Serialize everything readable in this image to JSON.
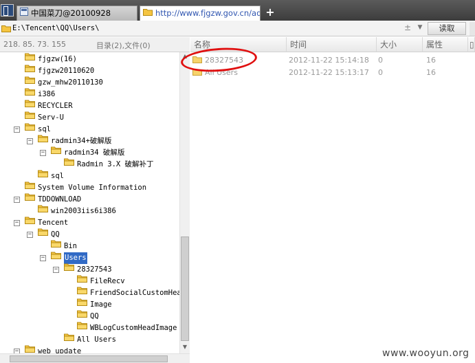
{
  "tabs": [
    {
      "label": "中国菜刀@20100928",
      "active": false
    },
    {
      "label": "http://www.fjgzw.gov.cn/ad...",
      "active": true
    }
  ],
  "address": {
    "path": "E:\\Tencent\\QQ\\Users\\",
    "read_button": "读取",
    "plusminus": "±"
  },
  "status": {
    "ip": "218. 85. 73. 155",
    "counts": "目录(2),文件(0)"
  },
  "tree": [
    {
      "label": "fjgzw(16)",
      "depth": 0,
      "toggle": "",
      "selected": false
    },
    {
      "label": "fjgzw20110620",
      "depth": 0,
      "toggle": "",
      "selected": false
    },
    {
      "label": "gzw_mhw20110130",
      "depth": 0,
      "toggle": "",
      "selected": false
    },
    {
      "label": "i386",
      "depth": 0,
      "toggle": "",
      "selected": false
    },
    {
      "label": "RECYCLER",
      "depth": 0,
      "toggle": "",
      "selected": false
    },
    {
      "label": "Serv-U",
      "depth": 0,
      "toggle": "",
      "selected": false
    },
    {
      "label": "sql",
      "depth": 0,
      "toggle": "−",
      "selected": false
    },
    {
      "label": "radmin34+破解版",
      "depth": 1,
      "toggle": "−",
      "selected": false
    },
    {
      "label": "radmin34 破解版",
      "depth": 2,
      "toggle": "−",
      "selected": false
    },
    {
      "label": "Radmin 3.X 破解补丁",
      "depth": 3,
      "toggle": "",
      "selected": false
    },
    {
      "label": "sql",
      "depth": 1,
      "toggle": "",
      "selected": false
    },
    {
      "label": "System Volume Information",
      "depth": 0,
      "toggle": "",
      "selected": false
    },
    {
      "label": "TDDOWNLOAD",
      "depth": 0,
      "toggle": "−",
      "selected": false
    },
    {
      "label": "win2003iis6i386",
      "depth": 1,
      "toggle": "",
      "selected": false
    },
    {
      "label": "Tencent",
      "depth": 0,
      "toggle": "−",
      "selected": false
    },
    {
      "label": "QQ",
      "depth": 1,
      "toggle": "−",
      "selected": false
    },
    {
      "label": "Bin",
      "depth": 2,
      "toggle": "",
      "selected": false
    },
    {
      "label": "Users",
      "depth": 2,
      "toggle": "−",
      "selected": true
    },
    {
      "label": "28327543",
      "depth": 3,
      "toggle": "−",
      "selected": false
    },
    {
      "label": "FileRecv",
      "depth": 4,
      "toggle": "",
      "selected": false
    },
    {
      "label": "FriendSocialCustomHead",
      "depth": 4,
      "toggle": "",
      "selected": false
    },
    {
      "label": "Image",
      "depth": 4,
      "toggle": "",
      "selected": false
    },
    {
      "label": "QQ",
      "depth": 4,
      "toggle": "",
      "selected": false
    },
    {
      "label": "WBLogCustomHeadImage",
      "depth": 4,
      "toggle": "",
      "selected": false
    },
    {
      "label": "All Users",
      "depth": 3,
      "toggle": "",
      "selected": false
    },
    {
      "label": "web_update",
      "depth": 0,
      "toggle": "−",
      "selected": false
    }
  ],
  "columns": {
    "name": "名称",
    "time": "时间",
    "size": "大小",
    "attr": "属性"
  },
  "files": [
    {
      "name": "28327543",
      "time": "2012-11-22 15:14:18",
      "size": "0",
      "attr": "16"
    },
    {
      "name": "All Users",
      "time": "2012-11-22 15:13:17",
      "size": "0",
      "attr": "16"
    }
  ],
  "watermark": "www.wooyun.org",
  "colors": {
    "selection": "#316ac5",
    "annotation": "#e01010",
    "folder": "#f5c542"
  }
}
